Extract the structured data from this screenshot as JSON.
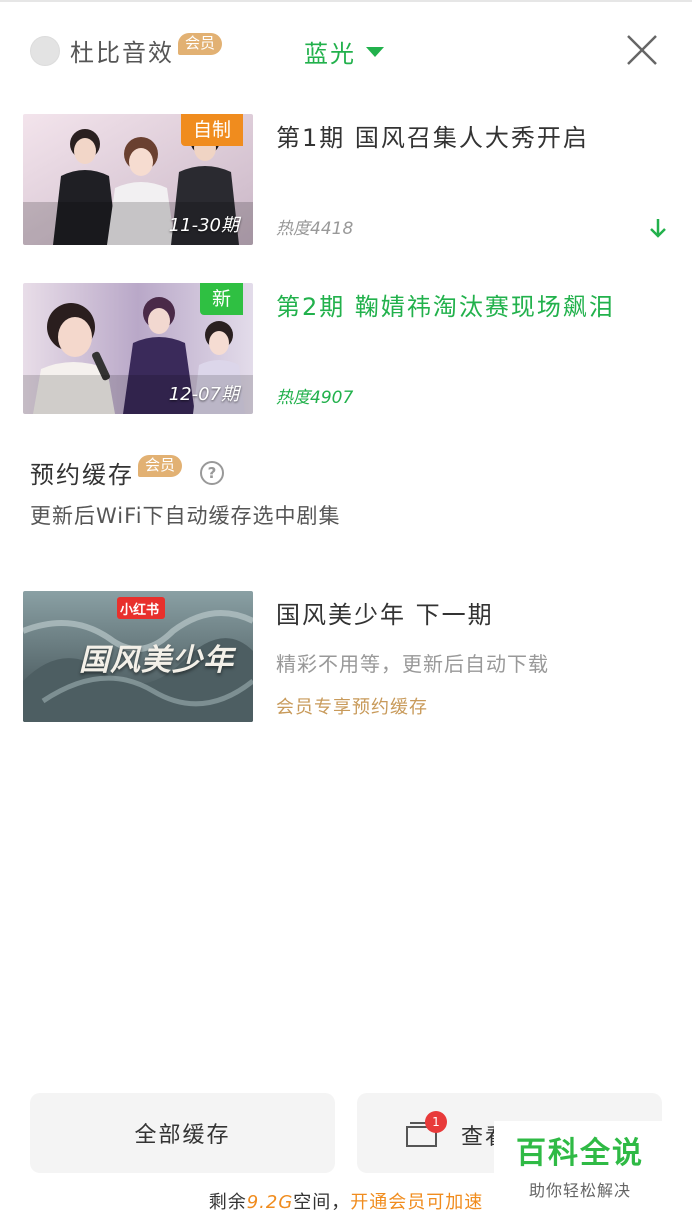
{
  "header": {
    "dolby_label": "杜比音效",
    "dolby_badge": "会员",
    "quality_label": "蓝光"
  },
  "episodes": [
    {
      "tag": "自制",
      "period": "11-30期",
      "title": "第1期  国风召集人大秀开启",
      "heat": "热度4418",
      "selected": false
    },
    {
      "tag": "新",
      "period": "12-07期",
      "title": "第2期  鞠婧祎淘汰赛现场飙泪",
      "heat": "热度4907",
      "selected": true
    }
  ],
  "reserve": {
    "title": "预约缓存",
    "badge": "会员",
    "description": "更新后WiFi下自动缓存选中剧集",
    "next": {
      "thumb_brand": "小红书",
      "thumb_title": "国风美少年",
      "title": "国风美少年  下一期",
      "subtitle": "精彩不用等，更新后自动下载",
      "vip_note": "会员专享预约缓存"
    }
  },
  "bottom": {
    "all_cache_label": "全部缓存",
    "view_cache_label": "查看缓存",
    "view_cache_count": "1",
    "storage_prefix": "剩余",
    "storage_value": "9.2G",
    "storage_suffix": "空间，",
    "upgrade_label": "开通会员可加速"
  },
  "watermark": {
    "title": "百科全说",
    "subtitle": "助你轻松解决"
  },
  "colors": {
    "accent_green": "#22b14c",
    "vip_gold": "#e2b173",
    "tag_orange": "#f08c1e",
    "tag_green": "#2fc042"
  }
}
